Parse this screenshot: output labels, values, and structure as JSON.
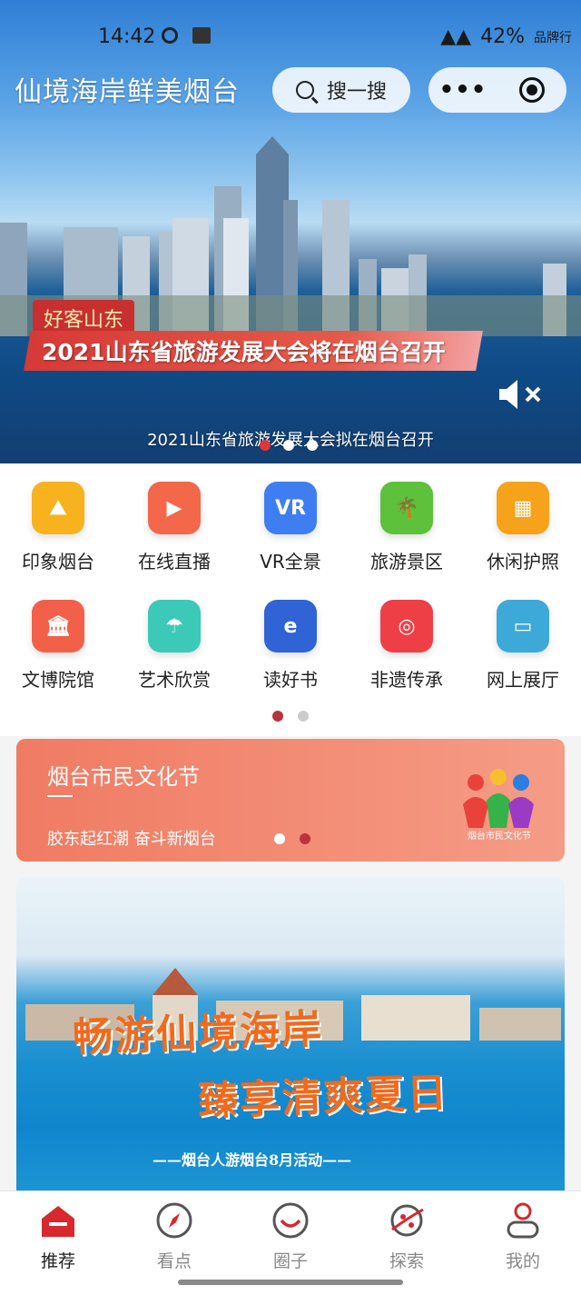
{
  "status_bar": {
    "time": "14:42",
    "battery": "42%",
    "carrier": "品牌行"
  },
  "header": {
    "logo_text": "仙境海岸鲜美烟台",
    "search_label": "搜一搜",
    "more_label": "•••"
  },
  "hero": {
    "tag": "好客山东",
    "headline": "2021山东省旅游发展大会将在烟台召开",
    "caption": "2021山东省旅游发展大会拟在烟台召开",
    "mute_icon": "speaker-muted-icon",
    "active_dot": 0
  },
  "grid": {
    "items": [
      {
        "label": "印象烟台",
        "icon": "map-icon",
        "color": "#f7b21e"
      },
      {
        "label": "在线直播",
        "icon": "tv-icon",
        "color": "#f3674a"
      },
      {
        "label": "VR全景",
        "icon": "vr-icon",
        "color": "#3e7ef0"
      },
      {
        "label": "旅游景区",
        "icon": "palm-tree-icon",
        "color": "#5ec13c"
      },
      {
        "label": "休闲护照",
        "icon": "passport-icon",
        "color": "#f6a21b"
      },
      {
        "label": "文博院馆",
        "icon": "museum-icon",
        "color": "#f2604a"
      },
      {
        "label": "艺术欣赏",
        "icon": "dancer-icon",
        "color": "#3dc9b7"
      },
      {
        "label": "读好书",
        "icon": "ebook-icon",
        "color": "#2f63d6"
      },
      {
        "label": "非遗传承",
        "icon": "heritage-icon",
        "color": "#ee3f46"
      },
      {
        "label": "网上展厅",
        "icon": "monitor-icon",
        "color": "#3da9d8"
      }
    ],
    "page": 1,
    "pages": 2
  },
  "festival": {
    "title": "烟台市民文化节",
    "subtitle": "胶东起红潮 奋斗新烟台",
    "logo_text": "烟台市民文化节",
    "active_dot": 1
  },
  "promo": {
    "line1": "畅游仙境海岸",
    "line2": "臻享清爽夏日",
    "line3": "——烟台人游烟台8月活动——"
  },
  "tabs": [
    {
      "label": "推荐",
      "icon": "home-icon",
      "active": true
    },
    {
      "label": "看点",
      "icon": "compass-icon",
      "active": false
    },
    {
      "label": "圈子",
      "icon": "smile-circle-icon",
      "active": false
    },
    {
      "label": "探索",
      "icon": "planet-icon",
      "active": false
    },
    {
      "label": "我的",
      "icon": "user-icon",
      "active": false
    }
  ],
  "colors": {
    "accent": "#c8302f",
    "festival_bg": "#f07b63"
  }
}
